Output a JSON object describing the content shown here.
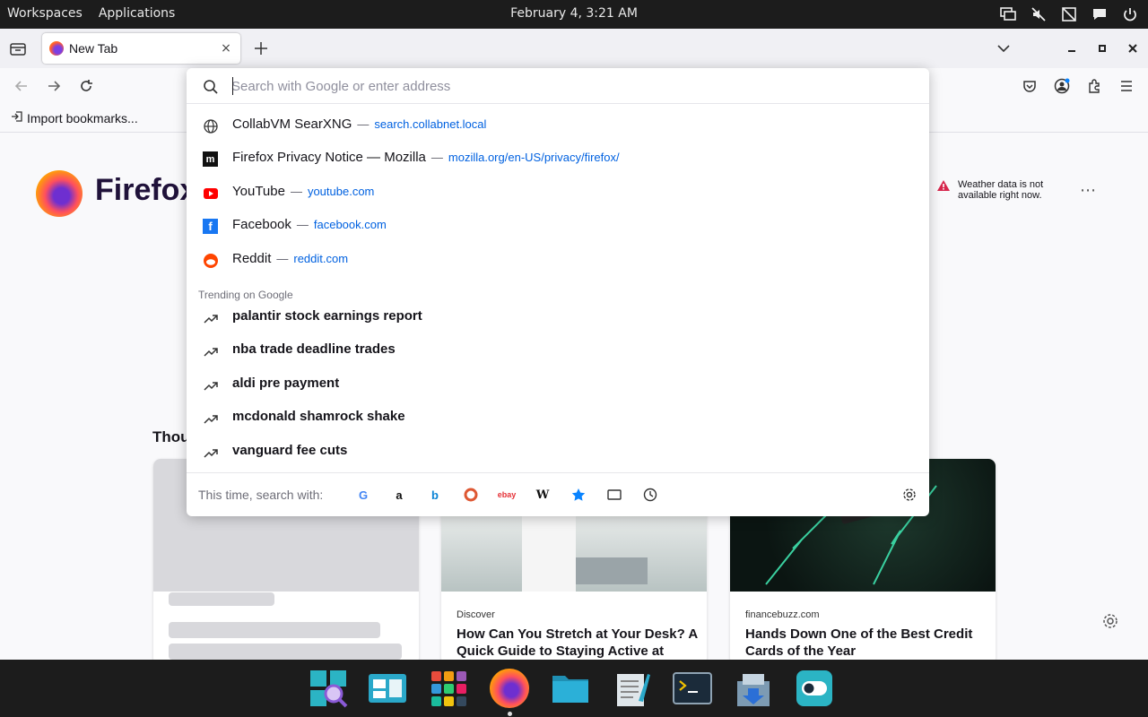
{
  "topbar": {
    "workspaces": "Workspaces",
    "applications": "Applications",
    "clock": "February 4, 3:21 AM",
    "tray_icons": [
      "display-icon",
      "mute-icon",
      "network-off-icon",
      "chat-icon",
      "power-icon"
    ]
  },
  "tab": {
    "title": "New Tab",
    "close": "×"
  },
  "bookmarks": {
    "import_label": "Import bookmarks..."
  },
  "urlbar": {
    "placeholder": "Search with Google or enter address",
    "value": ""
  },
  "suggestions": [
    {
      "icon": "globe-icon",
      "title": "CollabVM SearXNG",
      "url": "search.collabnet.local"
    },
    {
      "icon": "mozilla-icon",
      "title": "Firefox Privacy Notice — Mozilla",
      "url": "mozilla.org/en-US/privacy/firefox/"
    },
    {
      "icon": "youtube-icon",
      "title": "YouTube",
      "url": "youtube.com"
    },
    {
      "icon": "facebook-icon",
      "title": "Facebook",
      "url": "facebook.com"
    },
    {
      "icon": "reddit-icon",
      "title": "Reddit",
      "url": "reddit.com"
    }
  ],
  "trending_label": "Trending on Google",
  "trending": [
    "palantir stock earnings report",
    "nba trade deadline trades",
    "aldi pre payment",
    "mcdonald shamrock shake",
    "vanguard fee cuts"
  ],
  "footer": {
    "label": "This time, search with:",
    "engines": [
      "google-icon",
      "amazon-icon",
      "bing-icon",
      "duckduckgo-icon",
      "ebay-icon",
      "wikipedia-icon",
      "bookmarks-icon",
      "tabs-icon",
      "history-icon"
    ]
  },
  "newtab": {
    "brand": "Firefox",
    "weather": "Weather data is not available right now.",
    "section_title": "Thou",
    "cards": [
      {
        "source": "",
        "title": ""
      },
      {
        "source": "Discover",
        "title": "How Can You Stretch at Your Desk? A Quick Guide to Staying Active at Work"
      },
      {
        "source": "financebuzz.com",
        "title": "Hands Down One of the Best Credit Cards of the Year"
      }
    ]
  },
  "dock": {
    "items": [
      "search-app-icon",
      "workspace-app-icon",
      "app-grid-icon",
      "firefox-icon",
      "files-icon",
      "text-editor-icon",
      "terminal-icon",
      "installer-icon",
      "settings-toggle-icon"
    ]
  }
}
